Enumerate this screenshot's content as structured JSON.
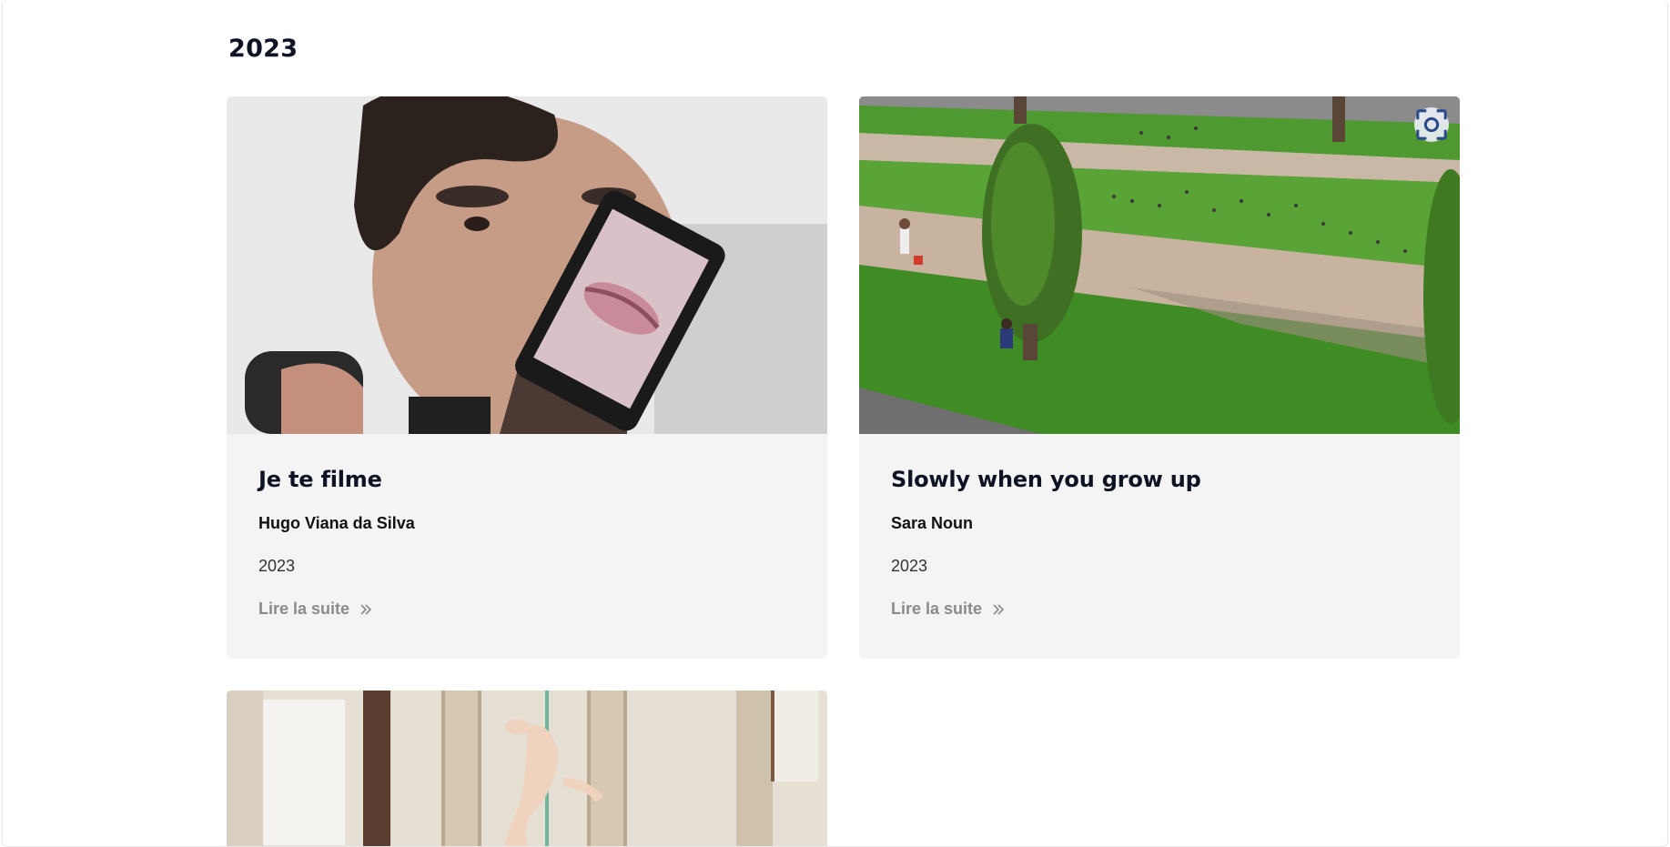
{
  "section": {
    "year_heading": "2023"
  },
  "cards": [
    {
      "title": "Je te filme",
      "author": "Hugo Viana da Silva",
      "year": "2023",
      "read_more": "Lire la suite"
    },
    {
      "title": "Slowly when you grow up",
      "author": "Sara Noun",
      "year": "2023",
      "read_more": "Lire la suite"
    }
  ],
  "icons": {
    "zoom": "focus-zoom-icon",
    "read_more": "double-chevron-right-icon"
  },
  "colors": {
    "heading": "#0e1324",
    "card_bg": "#f4f4f4",
    "link": "#8a8a8a"
  }
}
